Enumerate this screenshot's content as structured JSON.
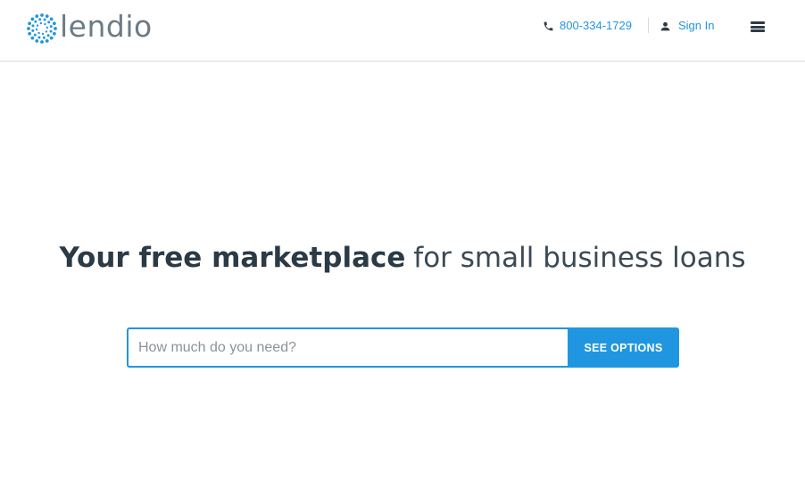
{
  "header": {
    "logo": {
      "text": "lendio",
      "icon": "lendio-dots-icon",
      "color": "#6c7b86",
      "accent": "#2196e0"
    },
    "phone": {
      "icon": "phone-icon",
      "number": "800-334-1729"
    },
    "signin": {
      "icon": "user-icon",
      "label": "Sign In"
    },
    "menu": {
      "icon": "hamburger-menu-icon"
    }
  },
  "hero": {
    "headline_bold": "Your free marketplace",
    "headline_light": "for small business loans"
  },
  "form": {
    "amount_placeholder": "How much do you need?",
    "amount_value": "",
    "submit_label": "SEE OPTIONS"
  },
  "colors": {
    "accent": "#2196e0",
    "text": "#2b3a45",
    "border": "#d9dde0"
  }
}
